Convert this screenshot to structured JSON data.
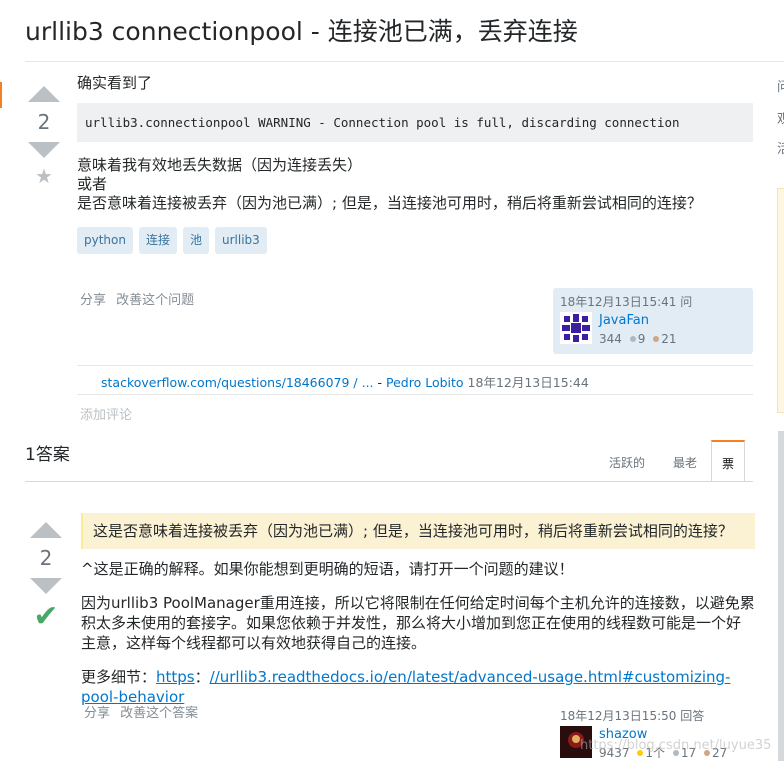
{
  "page": {
    "title": "urllib3 connectionpool - 连接池已满，丢弃连接"
  },
  "question": {
    "votes": "2",
    "intro": "确实看到了",
    "code": "urllib3.connectionpool WARNING - Connection pool is full, discarding connection",
    "lines": [
      "意味着我有效地丢失数据（因为连接丢失）",
      "或者",
      "是否意味着连接被丢弃（因为池已满）; 但是，当连接池可用时，稍后将重新尝试相同的连接？"
    ],
    "tags": [
      "python",
      "连接",
      "池",
      "urllib3"
    ],
    "menu": {
      "share": "分享",
      "improve": "改善这个问题"
    },
    "asked": {
      "time": "18年12月13日15:41 问",
      "user": "JavaFan",
      "rep": "344",
      "silver": "9",
      "bronze": "21"
    },
    "comment": {
      "link": "stackoverflow.com/questions/18466079 / ...",
      "sep": " - ",
      "author": "Pedro Lobito",
      "time": "18年12月13日15:44"
    },
    "add_comment": "添加评论"
  },
  "answers": {
    "header": "1答案",
    "tabs": [
      "活跃的",
      "最老",
      "票"
    ],
    "active_tab": "票"
  },
  "answer": {
    "votes": "2",
    "quote": "这是否意味着连接被丢弃（因为池已满）; 但是，当连接池可用时，稍后将重新尝试相同的连接？",
    "p1": "^这是正确的解释。如果你能想到更明确的短语，请打开一个问题的建议！",
    "p2": "因为urllib3 PoolManager重用连接，所以它将限制在任何给定时间每个主机允许的连接数，以避免累积太多未使用的套接字。如果您依赖于并发性，那么将大小增加到您正在使用的线程数可能是一个好主意，这样每个线程都可以有效地获得自己的连接。",
    "more_label": "更多细节：",
    "link1": "https",
    "colon": "：",
    "link2": "//urllib3.readthedocs.io/en/latest/advanced-usage.html#customizing-pool-behavior",
    "menu": {
      "share": "分享",
      "improve": "改善这个答案"
    },
    "answered": {
      "time": "18年12月13日15:50 回答",
      "user": "shazow",
      "rep": "9437",
      "gold": "1个",
      "silver": "17",
      "bronze": "27"
    }
  },
  "sidebar": {
    "items": [
      "问",
      "观",
      "活"
    ]
  },
  "watermark": "https://blog.csdn.net/luyue35"
}
